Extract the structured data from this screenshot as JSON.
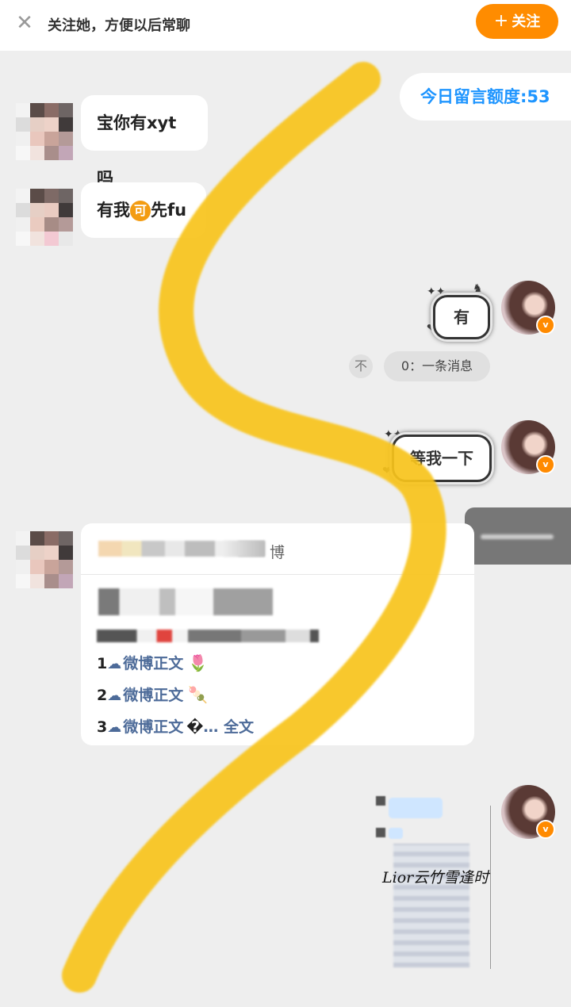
{
  "header": {
    "close_icon": "close-icon",
    "tip": "关注她，方便以后常聊",
    "follow_label": "关注",
    "follow_icon": "+",
    "accent": "#ff8c00"
  },
  "quota": {
    "text": "今日留言额度:53",
    "color": "#1e95ff"
  },
  "messages": {
    "m1": "宝你有xyt吗",
    "m2_a": "有我",
    "m2_coin": "可",
    "m2_b": "先fu",
    "m3": "有",
    "pin_icon": "不",
    "one_message": "0：一条消息",
    "m4": "等我一下"
  },
  "card": {
    "title_tail": "博",
    "items": [
      {
        "num": "1",
        "text": "微博正文",
        "emoji": "🌷"
      },
      {
        "num": "2",
        "text": "微博正文",
        "emoji": "🍡"
      },
      {
        "num": "3",
        "text": "微博正文",
        "emoji": "�",
        "more": "… 全文"
      }
    ],
    "link_color": "#4d6b99"
  },
  "screenshot": {
    "signature": "Lior云竹雪逢时"
  },
  "colors": {
    "highlight": "#f8c41a",
    "badge": "#ff8a00"
  }
}
